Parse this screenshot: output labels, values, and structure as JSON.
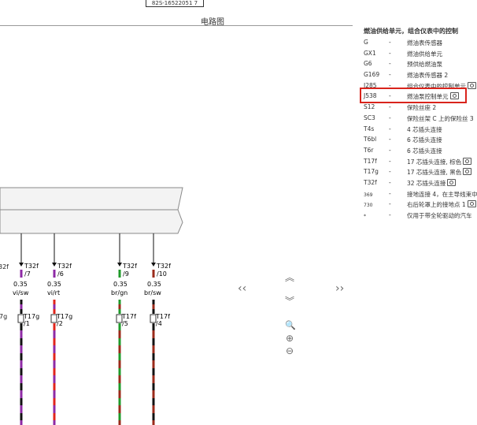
{
  "header": {
    "doc_id": "82S-16522051 7",
    "title": "电路图"
  },
  "legend": {
    "title": "燃油供给单元，组合仪表中的控制",
    "items": [
      {
        "code": "G",
        "dash": "-",
        "desc": "燃油表传感器",
        "camera": false
      },
      {
        "code": "GX1",
        "dash": "-",
        "desc": "燃油供给单元",
        "camera": false
      },
      {
        "code": "G6",
        "dash": "-",
        "desc": "预供给燃油泵",
        "camera": false
      },
      {
        "code": "G169",
        "dash": "-",
        "desc": "燃油表传感器 2",
        "camera": false
      },
      {
        "code": "J285",
        "dash": "-",
        "desc": "组合仪表中的控制单元",
        "camera": true
      },
      {
        "code": "J538",
        "dash": "-",
        "desc": "燃油泵控制单元",
        "camera": true
      },
      {
        "code": "S12",
        "dash": "-",
        "desc": "保险丝座 2",
        "camera": false
      },
      {
        "code": "SC3",
        "dash": "-",
        "desc": "保险丝架 C 上的保险丝 3",
        "camera": false
      },
      {
        "code": "T4s",
        "dash": "-",
        "desc": "4 芯插头连接",
        "camera": false
      },
      {
        "code": "T6bl",
        "dash": "-",
        "desc": "6 芯插头连接",
        "camera": false
      },
      {
        "code": "T6r",
        "dash": "-",
        "desc": "6 芯插头连接",
        "camera": false
      },
      {
        "code": "T17f",
        "dash": "-",
        "desc": "17 芯插头连接, 棕色",
        "camera": true
      },
      {
        "code": "T17g",
        "dash": "-",
        "desc": "17 芯插头连接, 黑色",
        "camera": true
      },
      {
        "code": "T32f",
        "dash": "-",
        "desc": "32 芯插头连接",
        "camera": true
      },
      {
        "code": "369",
        "dash": "-",
        "desc": "接地连接 4，在主导线束中",
        "camera": false,
        "small": true
      },
      {
        "code": "730",
        "dash": "-",
        "desc": "右后轮罩上的接地点 1",
        "camera": true,
        "small": true
      },
      {
        "code": "*",
        "dash": "-",
        "desc": "仅用于带全轮驱动的汽车",
        "camera": false,
        "small": true
      }
    ]
  },
  "diagram": {
    "top_connectors": [
      {
        "name": "T32f",
        "pin": "/7"
      },
      {
        "name": "T32f",
        "pin": "/6"
      },
      {
        "name": "T32f",
        "pin": "/9"
      },
      {
        "name": "T32f",
        "pin": "/10"
      }
    ],
    "partial_left_label": "32f",
    "wires": [
      {
        "size": "0.35",
        "color": "vi/sw",
        "stripe": [
          "#8e2aa5",
          "#111111"
        ]
      },
      {
        "size": "0.35",
        "color": "vi/rt",
        "stripe": [
          "#8e2aa5",
          "#e0241b"
        ]
      },
      {
        "size": "0.35",
        "color": "br/gn",
        "stripe": [
          "#9a2a1a",
          "#1f9a2a"
        ]
      },
      {
        "size": "0.35",
        "color": "br/sw",
        "stripe": [
          "#9a2a1a",
          "#111111"
        ]
      }
    ],
    "bottom_connectors": [
      {
        "name": "T17g",
        "pin": "/1"
      },
      {
        "name": "T17g",
        "pin": "/2"
      },
      {
        "name": "T17f",
        "pin": "/5"
      },
      {
        "name": "T17f",
        "pin": "/4"
      }
    ],
    "partial_bottom_left": "7g"
  },
  "nav": {
    "prev": "‹‹",
    "next": "››",
    "up": "︽",
    "down": "︾",
    "zoom_fit": "🔍",
    "zoom_in": "⊕",
    "zoom_out": "⊖"
  }
}
